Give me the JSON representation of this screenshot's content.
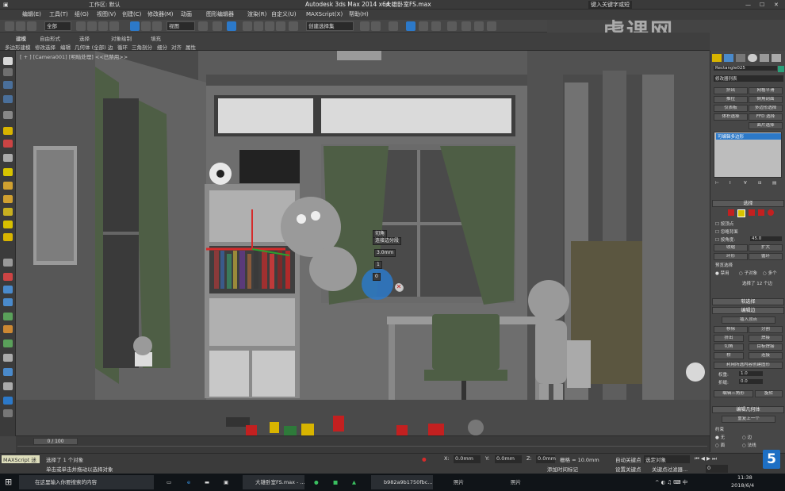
{
  "titlebar": {
    "workspace_label": "工作区: 默认",
    "window_title": "Autodesk 3ds Max  2014 x64",
    "file_name": "大雄卧室FS.max",
    "search_placeholder": "键入关键字或短语"
  },
  "menubar": {
    "items": [
      "编辑(E)",
      "工具(T)",
      "组(G)",
      "视图(V)",
      "创建(C)",
      "修改器(M)",
      "动画",
      "图形编辑器",
      "渲染(R)",
      "自定义(U)",
      "MAXScript(X)",
      "帮助(H)"
    ]
  },
  "toolbar": {
    "filter_value": "全部",
    "view_value": "视图",
    "selection_set_placeholder": "创建选择集"
  },
  "ribbon": {
    "tabs": [
      "建模",
      "自由形式",
      "选择",
      "对象绘制",
      "填充"
    ],
    "sub_items": [
      "多边形建模",
      "修改选择",
      "编辑",
      "几何体 (全部)",
      "边",
      "循环",
      "三角剖分",
      "细分",
      "对齐",
      "属性"
    ]
  },
  "viewport": {
    "label": "[ + ] [Camera001] [明暗处理] <<已禁用>>",
    "quad_menu": {
      "title": "切角",
      "subtitle": "连接边分段",
      "value1": "3.0mm",
      "value2": "1",
      "value3": "0"
    }
  },
  "command_panel": {
    "object_name": "Rectangle025",
    "modifier_list": "修改器列表",
    "buttons": [
      "挤出",
      "网格平滑",
      "推拉",
      "倒角剖面",
      "仪表板",
      "多边形选择",
      "体积选择",
      "FFD 选择",
      "面片选择"
    ],
    "stack_item": "可编辑多边形",
    "selection_title": "选择",
    "checkbox_labels": [
      "按顶点",
      "忽略背面",
      "按角度:"
    ],
    "angle_value": "45.0",
    "shrink": "收缩",
    "grow": "扩大",
    "ring": "环形",
    "loop": "循环",
    "preview_label": "预览选择",
    "preview_options": [
      "禁用",
      "子对象",
      "多个"
    ],
    "selected_count": "选择了 12 个边",
    "soft_selection": "软选择",
    "edit_edges": "编辑边",
    "insert_vertex": "插入顶点",
    "remove": "移除",
    "split": "分割",
    "extrude": "挤出",
    "weld": "焊接",
    "chamfer": "切角",
    "target_weld": "目标焊接",
    "bridge": "桥",
    "connect": "连接",
    "create_shape": "利用所选内容创建图形",
    "weight_label": "权重:",
    "weight_value": "1.0",
    "crease_label": "折缝:",
    "crease_value": "0.0",
    "edit_tri": "编辑三角形",
    "turn": "旋转",
    "edit_geometry": "编辑几何体",
    "repeat_last": "重复上一个",
    "constraints": "约束",
    "constraint_options": [
      "无",
      "边",
      "面",
      "法线"
    ]
  },
  "timeslider": {
    "frame_readout": "0 / 100"
  },
  "statusbar": {
    "script_label": "MAXScript 迷",
    "line1": "选择了 1 个对象",
    "line2": "单击或单击并拖动以选择对象",
    "x_label": "X:",
    "x_value": "0.0mm",
    "y_label": "Y:",
    "y_value": "0.0mm",
    "z_label": "Z:",
    "z_value": "0.0mm",
    "grid_label": "栅格 = 10.0mm",
    "auto_key": "自动关键点",
    "selected_obj": "选定对象",
    "set_key": "设置关键点",
    "key_filters": "关键点过滤器...",
    "add_time_tag": "添加时间标记",
    "frame_value": "0"
  },
  "taskbar": {
    "search_placeholder": "在这里输入你要搜索的内容",
    "apps": [
      "大雄卧室FS.max - ...",
      "b982a9b1750fbc...",
      "照片",
      "照片"
    ],
    "time": "11:38",
    "date": "2018/6/4"
  },
  "watermark": "虎课网",
  "badge": "5",
  "colors": {
    "accent": "#2c79c9",
    "viewport_bg": "#5a5a5a",
    "curtain": "#4e5e45",
    "selection_red": "#d52b2b"
  }
}
